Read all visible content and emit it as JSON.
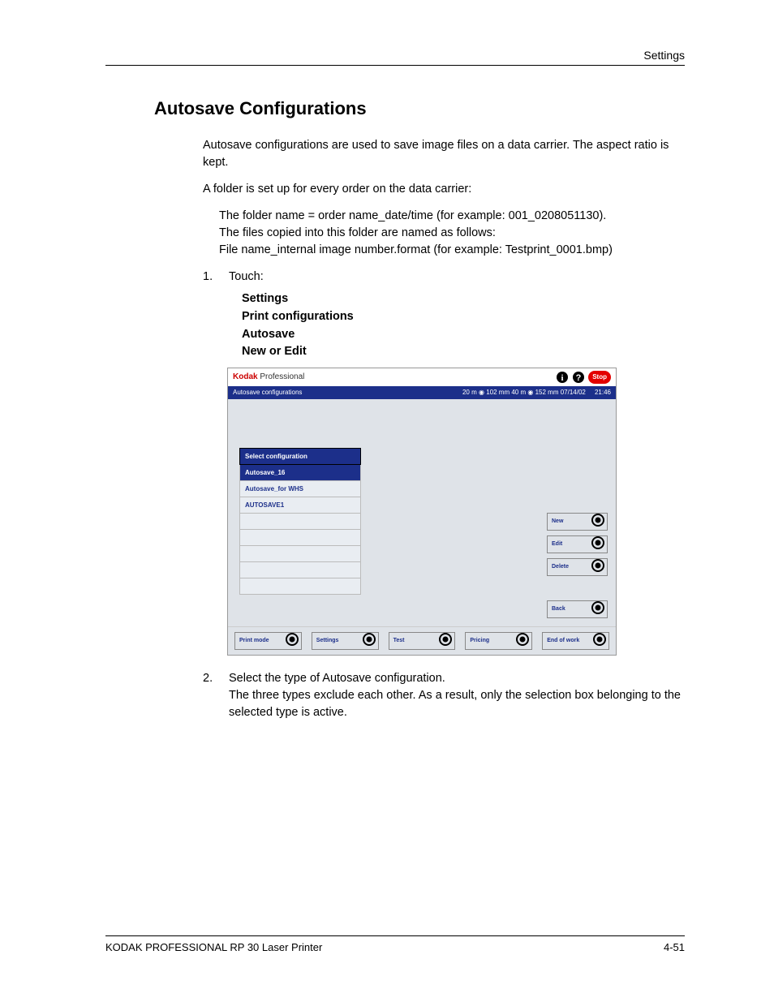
{
  "header": {
    "section_label": "Settings"
  },
  "content": {
    "heading": "Autosave Configurations",
    "p1": "Autosave configurations are used to save image files on a data carrier. The aspect ratio is kept.",
    "p2": "A folder is set up for every order on the data carrier:",
    "p3": "The folder name = order name_date/time (for example: 001_0208051130).",
    "p4": "The files copied into this folder are named as follows:",
    "p5": "File name_internal image number.format (for example: Testprint_0001.bmp)",
    "step1_num": "1.",
    "step1_text": "Touch:",
    "step1_items": {
      "a": "Settings",
      "b": "Print configurations",
      "c": "Autosave",
      "d": "New or Edit"
    },
    "step2_num": "2.",
    "step2_a": "Select the type of Autosave configuration.",
    "step2_b": "The three types exclude each other. As a result, only the selection box belonging to the selected type is active."
  },
  "screenshot": {
    "brand1": "Kodak",
    "brand2": " Professional",
    "stop": "Stop",
    "status_left": "Autosave configurations",
    "status_right_a": "20 m",
    "status_right_b": "102 mm  40 m",
    "status_right_c": "152 mm 07/14/02",
    "status_time": "21:46",
    "select_header": "Select configuration",
    "rows": {
      "r0": "Autosave_16",
      "r1": "Autosave_for WHS",
      "r2": "AUTOSAVE1",
      "r3": "",
      "r4": "",
      "r5": "",
      "r6": "",
      "r7": ""
    },
    "buttons": {
      "new": "New",
      "edit": "Edit",
      "delete": "Delete",
      "back": "Back"
    },
    "footer_buttons": {
      "b1": "Print mode",
      "b2": "Settings",
      "b3": "Test",
      "b4": "Pricing",
      "b5": "End of work"
    }
  },
  "footer": {
    "left": "KODAK PROFESSIONAL RP 30 Laser Printer",
    "right": "4-51"
  }
}
